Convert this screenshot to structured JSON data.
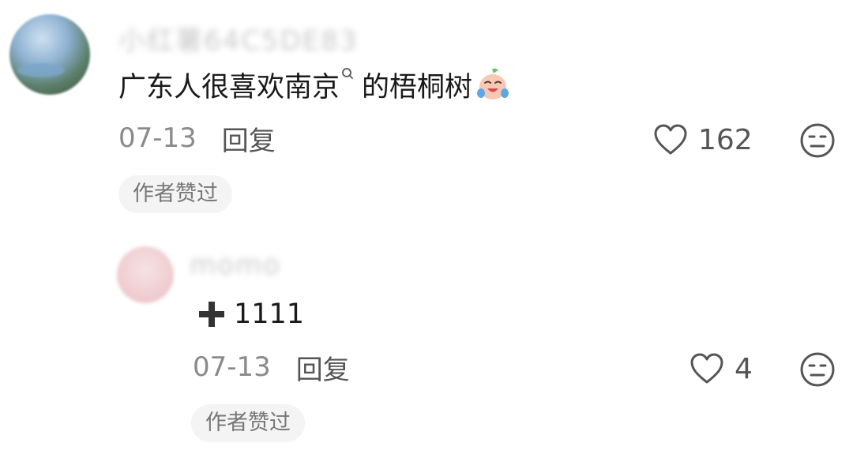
{
  "comments": [
    {
      "username": "小红薯64C5DE83",
      "text_before": "广东人很喜欢南京",
      "text_after": "的梧桐树",
      "date": "07-13",
      "reply_label": "回复",
      "likes": "162",
      "badge": "作者赞过",
      "icons": [
        "search-icon",
        "crying-laughing-emoji-icon",
        "heart-icon",
        "dislike-face-icon"
      ]
    },
    {
      "username": "momo",
      "text": "1111",
      "date": "07-13",
      "reply_label": "回复",
      "likes": "4",
      "badge": "作者赞过",
      "icons": [
        "plus-icon",
        "heart-icon",
        "dislike-face-icon"
      ]
    }
  ],
  "colors": {
    "text": "#1a1a1a",
    "meta": "#8a8a8a",
    "badge_bg": "#f4f4f4",
    "icon": "#555555"
  }
}
